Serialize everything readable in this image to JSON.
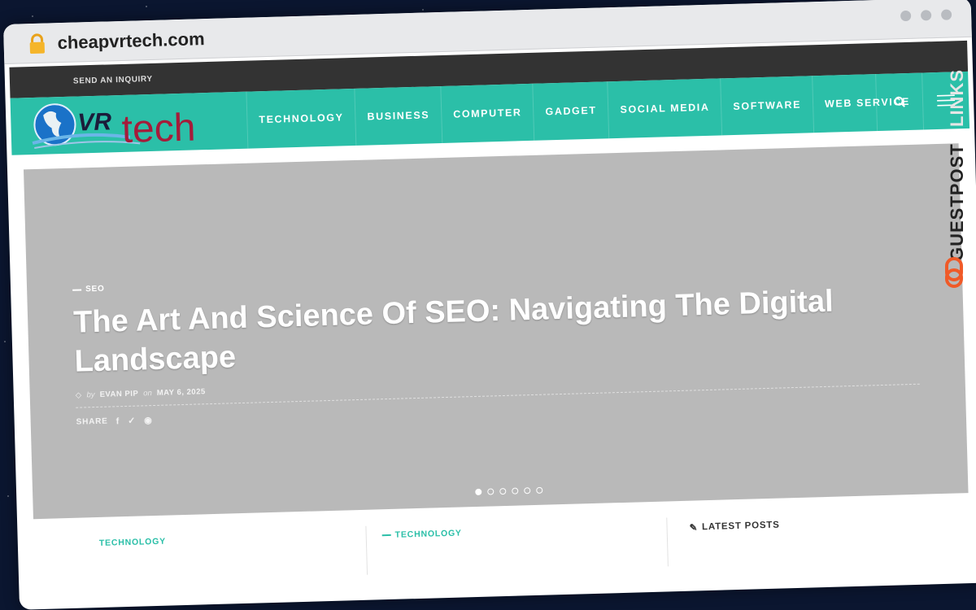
{
  "browser": {
    "url": "cheapvrtech.com",
    "lock_icon": "lock-icon"
  },
  "site": {
    "topbar_link": "SEND AN INQUIRY",
    "logo_text_prefix": "VR",
    "logo_text": "tech",
    "menu": [
      "TECHNOLOGY",
      "BUSINESS",
      "COMPUTER",
      "GADGET",
      "SOCIAL MEDIA",
      "SOFTWARE",
      "WEB SERVICE"
    ],
    "accent_color": "#2bbfa8"
  },
  "hero": {
    "category": "SEO",
    "title": "The Art And Science Of SEO: Navigating The Digital Landscape",
    "by_label": "by",
    "author": "EVAN PIP",
    "on_label": "on",
    "date": "MAY 6, 2025",
    "share_label": "SHARE",
    "share_icons": [
      "facebook-icon",
      "twitter-icon",
      "pinterest-icon"
    ],
    "slide_count": 6,
    "active_slide": 1
  },
  "below": {
    "col1_category": "TECHNOLOGY",
    "col2_category": "TECHNOLOGY",
    "sidebar_heading": "LATEST POSTS"
  },
  "watermark": {
    "part1": "GUESTPOST",
    "part2": "LINKS"
  }
}
